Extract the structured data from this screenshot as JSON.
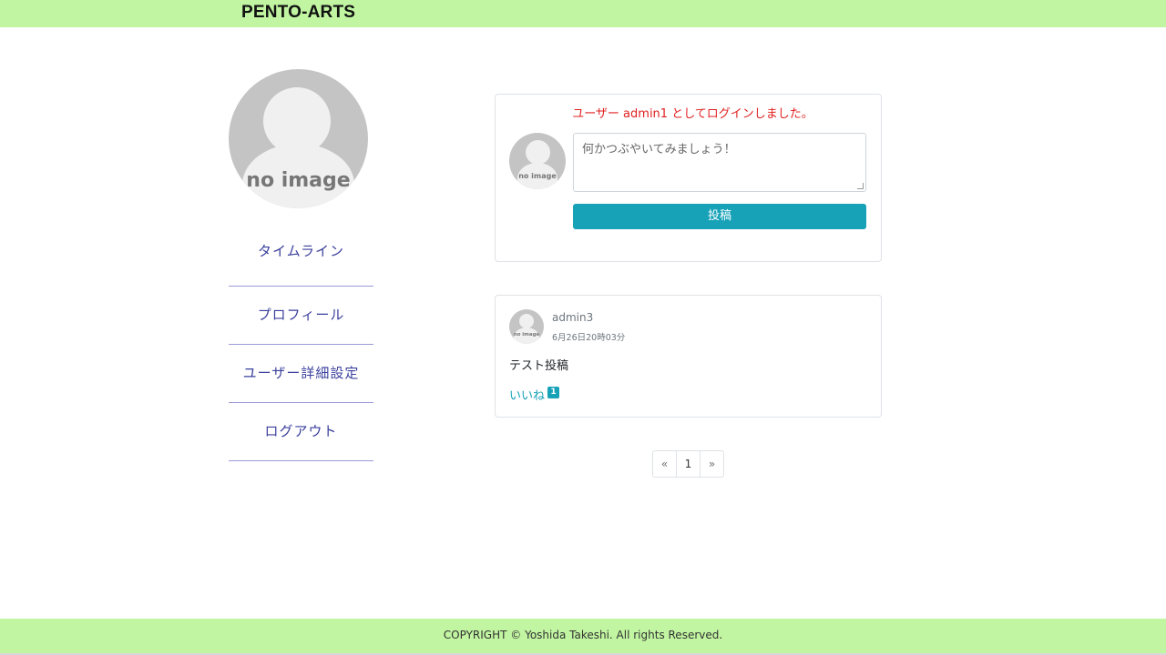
{
  "header": {
    "brand": "PENTO-ARTS"
  },
  "sidebar": {
    "avatar_label": "no image",
    "nav": [
      {
        "label": "タイムライン"
      },
      {
        "label": "プロフィール"
      },
      {
        "label": "ユーザー詳細設定"
      },
      {
        "label": "ログアウト"
      }
    ]
  },
  "composer": {
    "flash_message": "ユーザー admin1 としてログインしました。",
    "avatar_label": "no image",
    "placeholder": "何かつぶやいてみましょう！",
    "submit_label": "投稿"
  },
  "feed": {
    "posts": [
      {
        "avatar_label": "no image",
        "author": "admin3",
        "timestamp": "6月26日20時03分",
        "body": "テスト投稿",
        "like_label": "いいね",
        "like_count": "1"
      }
    ]
  },
  "pagination": {
    "prev": "«",
    "pages": [
      "1"
    ],
    "next": "»"
  },
  "footer": {
    "copyright": "COPYRIGHT © Yoshida Takeshi. All rights Reserved."
  },
  "colors": {
    "header_bg": "#c1f5a1",
    "accent": "#17a2b8",
    "nav_text": "#3a3f9c",
    "flash_text": "#e02020"
  }
}
